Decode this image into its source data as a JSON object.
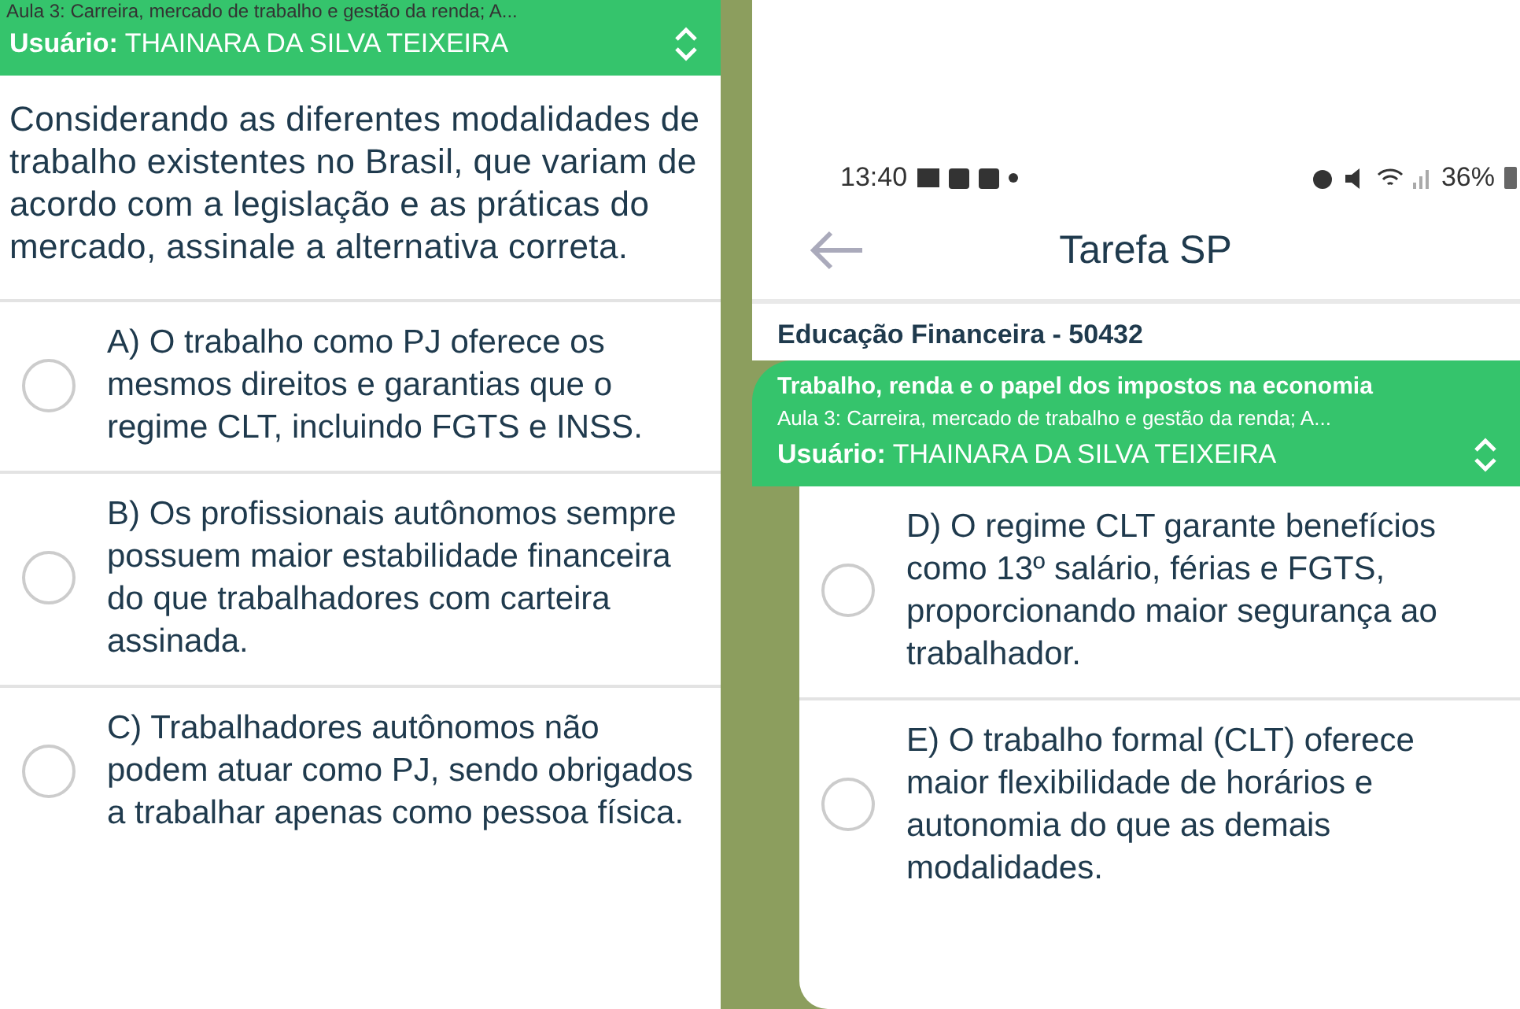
{
  "left": {
    "lesson_subtitle": "Aula 3: Carreira, mercado de trabalho e gestão da renda; A...",
    "user": {
      "label": "Usuário:",
      "name": "THAINARA DA SILVA TEIXEIRA"
    },
    "question": "Considerando as diferentes modalidades de trabalho existentes no Brasil, que variam de acordo com a legislação e as práticas do mercado, assinale a alternativa correta.",
    "options": [
      {
        "text": "A) O trabalho como PJ oferece os mesmos direitos e garantias que o regime CLT, incluindo FGTS e INSS.",
        "selected": false
      },
      {
        "text": "B) Os profissionais autônomos sempre possuem maior estabilidade financeira do que trabalhadores com carteira assinada.",
        "selected": false
      },
      {
        "text": "C) Trabalhadores autônomos não podem atuar como PJ, sendo obrigados a trabalhar apenas como pessoa física.",
        "selected": false
      }
    ]
  },
  "right": {
    "status_bar": {
      "time": "13:40",
      "battery": "36%"
    },
    "title": "Tarefa SP",
    "course": "Educação Financeira - 50432",
    "lesson_title": "Trabalho, renda e o papel dos impostos na economia",
    "lesson_subtitle": "Aula 3: Carreira, mercado de trabalho e gestão da renda; A...",
    "user": {
      "label": "Usuário:",
      "name": "THAINARA DA SILVA TEIXEIRA"
    },
    "options": [
      {
        "text": "D) O regime CLT garante benefícios como 13º salário, férias e FGTS, proporcionando maior segurança ao trabalhador.",
        "selected": false
      },
      {
        "text": "E) O trabalho formal (CLT) oferece maior flexibilidade de horários e autonomia do que as demais modalidades.",
        "selected": false
      }
    ]
  }
}
